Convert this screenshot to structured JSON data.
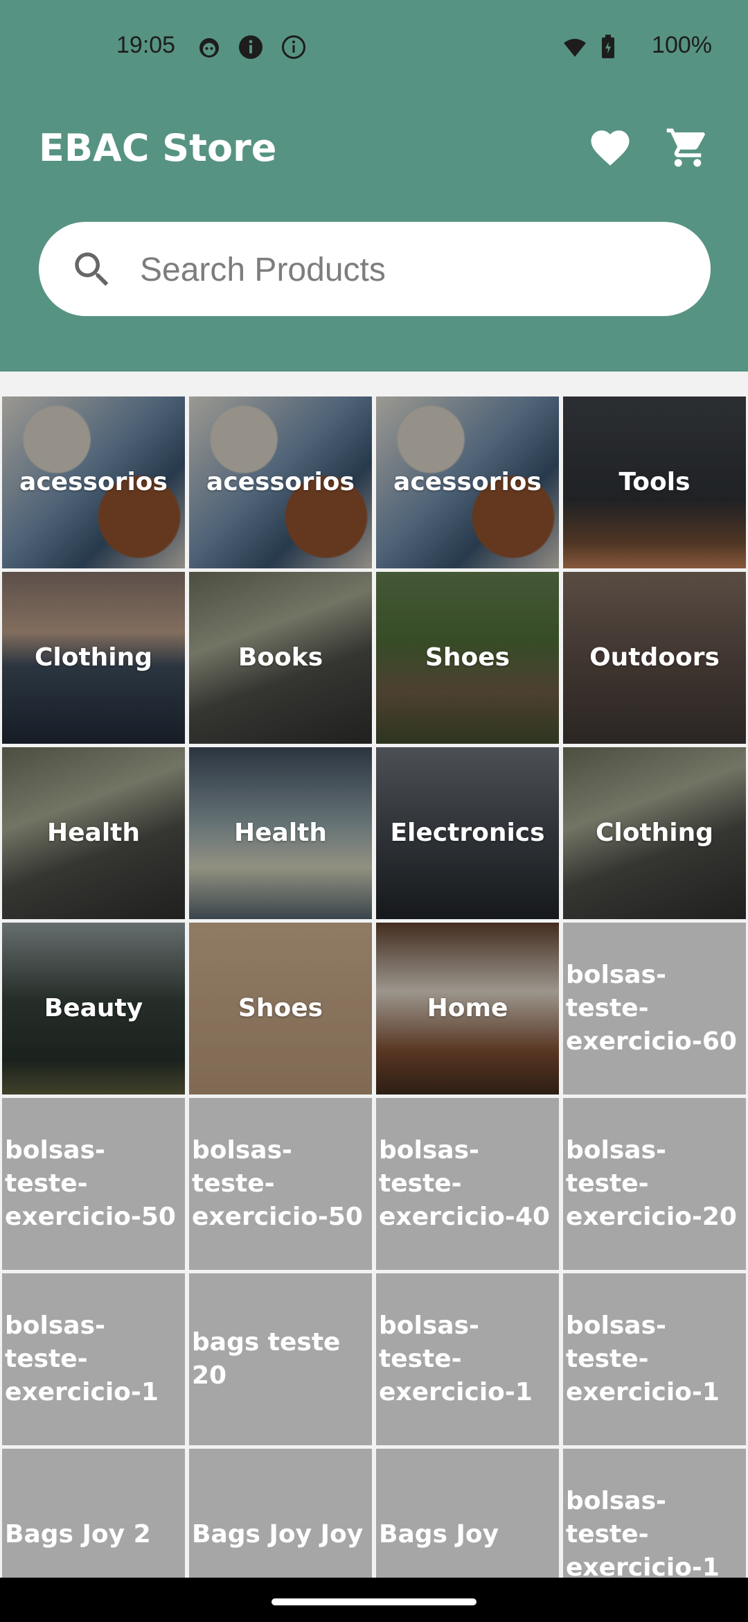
{
  "status_bar": {
    "time": "19:05",
    "battery": "100%",
    "icons": [
      "cat-face-icon",
      "info-filled-icon",
      "info-outline-icon",
      "wifi-icon",
      "battery-icon"
    ]
  },
  "app_bar": {
    "title": "EBAC Store",
    "favorites_icon": "heart-icon",
    "cart_icon": "cart-icon",
    "background": "#579382"
  },
  "search": {
    "placeholder": "Search Products",
    "icon": "search-icon"
  },
  "categories": [
    {
      "label": "acessorios",
      "style": "acc"
    },
    {
      "label": "acessorios",
      "style": "acc"
    },
    {
      "label": "acessorios",
      "style": "acc"
    },
    {
      "label": "Tools",
      "style": "tools"
    },
    {
      "label": "Clothing",
      "style": "sea"
    },
    {
      "label": "Books",
      "style": "cat"
    },
    {
      "label": "Shoes",
      "style": "path"
    },
    {
      "label": "Outdoors",
      "style": "crowd"
    },
    {
      "label": "Health",
      "style": "cat"
    },
    {
      "label": "Health",
      "style": "map"
    },
    {
      "label": "Electronics",
      "style": "legs"
    },
    {
      "label": "Clothing",
      "style": "cat"
    },
    {
      "label": "Beauty",
      "style": "forest"
    },
    {
      "label": "Shoes",
      "style": "shoes"
    },
    {
      "label": "Home",
      "style": "home"
    },
    {
      "label": "bolsas-teste-exercicio-60",
      "style": "plain"
    },
    {
      "label": "bolsas-teste-exercicio-50",
      "style": "plain"
    },
    {
      "label": "bolsas-teste-exercicio-50",
      "style": "plain"
    },
    {
      "label": "bolsas-teste-exercicio-40",
      "style": "plain"
    },
    {
      "label": "bolsas-teste-exercicio-20",
      "style": "plain"
    },
    {
      "label": "bolsas-teste-exercicio-1",
      "style": "plain"
    },
    {
      "label": "bags teste 20",
      "style": "plain"
    },
    {
      "label": "bolsas-teste-exercicio-1",
      "style": "plain"
    },
    {
      "label": "bolsas-teste-exercicio-1",
      "style": "plain"
    },
    {
      "label": "Bags Joy 2",
      "style": "plain"
    },
    {
      "label": "Bags Joy Joy",
      "style": "plain"
    },
    {
      "label": "Bags Joy",
      "style": "plain"
    },
    {
      "label": "bolsas-teste-exercicio-1",
      "style": "plain"
    }
  ]
}
